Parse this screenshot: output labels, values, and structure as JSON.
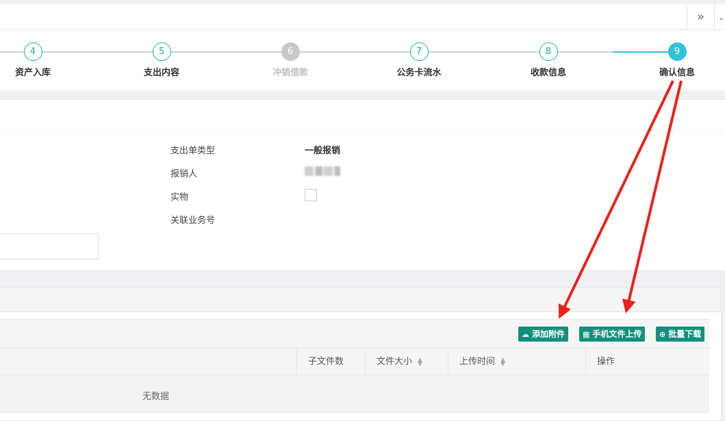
{
  "topbar": {
    "expand_icon": "double-chevron-right-icon",
    "more_icon": "chevron-down-icon"
  },
  "steps": [
    {
      "num": "4",
      "label": "资产入库",
      "state": "done"
    },
    {
      "num": "5",
      "label": "支出内容",
      "state": "done"
    },
    {
      "num": "6",
      "label": "冲销借款",
      "state": "disabled"
    },
    {
      "num": "7",
      "label": "公务卡流水",
      "state": "done"
    },
    {
      "num": "8",
      "label": "收款信息",
      "state": "done"
    },
    {
      "num": "9",
      "label": "确认信息",
      "state": "current"
    }
  ],
  "form": {
    "expense_type_label": "支出单类型",
    "expense_type_value": "一般报销",
    "claimant_label": "报销人",
    "physical_label": "实物",
    "related_no_label": "关联业务号"
  },
  "attachments": {
    "add_label": "添加附件",
    "mobile_upload_label": "手机文件上传",
    "batch_download_label": "批量下载",
    "columns": [
      "子文件数",
      "文件大小",
      "上传时间",
      "操作"
    ],
    "empty_text": "无数据"
  },
  "colors": {
    "accent": "#13907c",
    "step_done": "#1ab394",
    "step_current": "#2ec4d6",
    "annotation": "#e8231c"
  }
}
